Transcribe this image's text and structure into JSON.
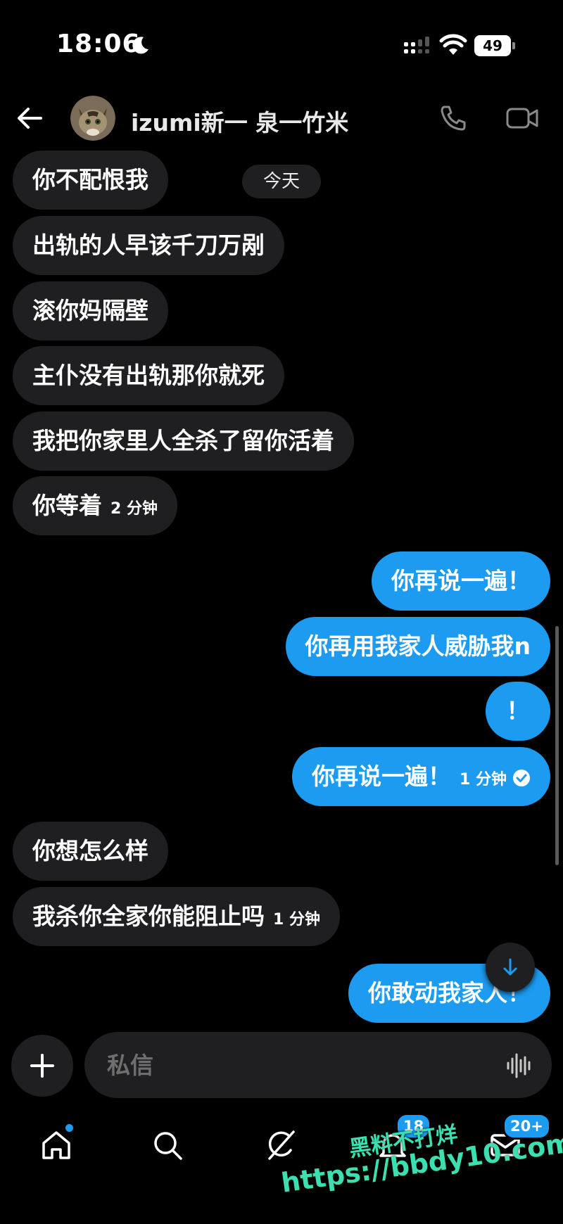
{
  "status_bar": {
    "time": "18:06",
    "battery": "49"
  },
  "header": {
    "contact_name": "izumi新一 泉一竹米"
  },
  "chat": {
    "date_chip": "今天",
    "messages": [
      {
        "side": "in",
        "text": "你不配恨我",
        "time": ""
      },
      {
        "side": "in",
        "text": "出轨的人早该千刀万剐",
        "time": ""
      },
      {
        "side": "in",
        "text": "滚你妈隔壁",
        "time": ""
      },
      {
        "side": "in",
        "text": "主仆没有出轨那你就死",
        "time": ""
      },
      {
        "side": "in",
        "text": "我把你家里人全杀了留你活着",
        "time": ""
      },
      {
        "side": "in",
        "text": "你等着",
        "time": "2 分钟"
      },
      {
        "side": "out",
        "text": "你再说一遍！",
        "time": ""
      },
      {
        "side": "out",
        "text": "你再用我家人威胁我n",
        "time": ""
      },
      {
        "side": "out",
        "text": "！",
        "time": ""
      },
      {
        "side": "out",
        "text": "你再说一遍！",
        "time": "1 分钟"
      },
      {
        "side": "in",
        "text": "你想怎么样",
        "time": ""
      },
      {
        "side": "in",
        "text": "我杀你全家你能阻止吗",
        "time": "1 分钟"
      },
      {
        "side": "out",
        "text": "你敢动我家人！",
        "time": ""
      }
    ]
  },
  "composer": {
    "placeholder": "私信"
  },
  "bottom_nav": {
    "items": [
      {
        "name": "home",
        "icon": "home-icon",
        "dot": true
      },
      {
        "name": "search",
        "icon": "search-icon"
      },
      {
        "name": "grok",
        "icon": "grok-icon"
      },
      {
        "name": "notifications",
        "icon": "bell-icon",
        "badge": "18"
      },
      {
        "name": "messages",
        "icon": "mail-icon",
        "badge": "20+"
      }
    ]
  },
  "watermark": {
    "title": "黑料不打烊",
    "url": "https://bbdy10.com"
  },
  "colors": {
    "background": "#000000",
    "incoming_bubble": "#1f1f21",
    "outgoing_bubble": "#1d9bf0",
    "watermark": "#3ce0b0"
  }
}
